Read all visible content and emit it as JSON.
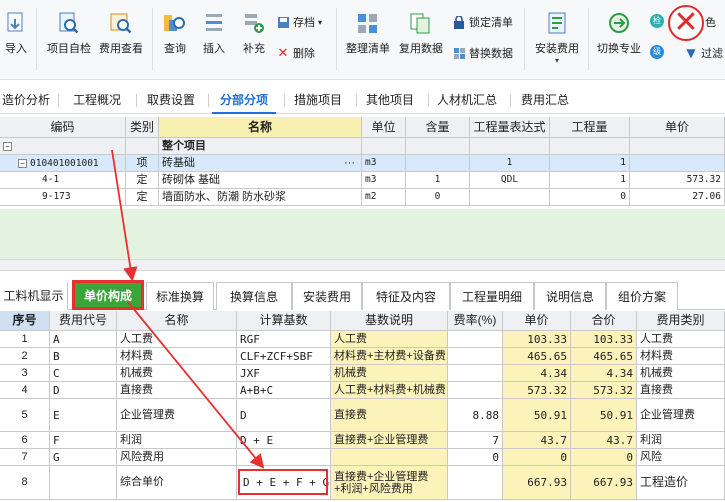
{
  "ribbon": {
    "import": "导入",
    "self_check": "项目自检",
    "fee_view": "费用查看",
    "query": "查询",
    "insert": "插入",
    "supplement": "补充",
    "archive": "存档",
    "delete": "删除",
    "organize": "整理清单",
    "reuse": "复用数据",
    "lock": "锁定清单",
    "replace": "替换数据",
    "install_fee": "安装费用",
    "switch_major": "切换专业",
    "filter": "过滤",
    "color_fragment": "色",
    "badge_1": "检",
    "badge_2": "级"
  },
  "top_tabs": [
    "造价分析",
    "工程概况",
    "取费设置",
    "分部分项",
    "措施项目",
    "其他项目",
    "人材机汇总",
    "费用汇总"
  ],
  "top_active": "分部分项",
  "grid1": {
    "headers": [
      "编码",
      "类别",
      "名称",
      "单位",
      "含量",
      "工程量表达式",
      "工程量",
      "单价"
    ],
    "whole_project": "整个项目",
    "rows": [
      {
        "code": "010401001001",
        "cat": "项",
        "name": "砖基础",
        "unit": "m3",
        "amount": "",
        "expr": "1",
        "qty": "1",
        "price": ""
      },
      {
        "code": "4-1",
        "cat": "定",
        "name": "砖砌体 基础",
        "unit": "m3",
        "amount": "1",
        "expr": "QDL",
        "qty": "1",
        "price": "573.32"
      },
      {
        "code": "9-173",
        "cat": "定",
        "name": "墙面防水、防潮 防水砂浆",
        "unit": "m2",
        "amount": "0",
        "expr": "",
        "qty": "0",
        "price": "27.06"
      }
    ],
    "more_indicator": "···"
  },
  "bottom_tabs": [
    "工料机显示",
    "单价构成",
    "标准换算",
    "换算信息",
    "安装费用",
    "特征及内容",
    "工程量明细",
    "说明信息",
    "组价方案"
  ],
  "bottom_active": "单价构成",
  "grid2": {
    "headers": [
      "序号",
      "费用代号",
      "名称",
      "计算基数",
      "基数说明",
      "费率(%)",
      "单价",
      "合价",
      "费用类别"
    ],
    "rows": [
      {
        "seq": "1",
        "code": "A",
        "name": "人工费",
        "base": "RGF",
        "desc": "人工费",
        "rate": "",
        "price": "103.33",
        "total": "103.33",
        "cat": "人工费"
      },
      {
        "seq": "2",
        "code": "B",
        "name": "材料费",
        "base": "CLF+ZCF+SBF",
        "desc": "材料费+主材费+设备费",
        "rate": "",
        "price": "465.65",
        "total": "465.65",
        "cat": "材料费"
      },
      {
        "seq": "3",
        "code": "C",
        "name": "机械费",
        "base": "JXF",
        "desc": "机械费",
        "rate": "",
        "price": "4.34",
        "total": "4.34",
        "cat": "机械费"
      },
      {
        "seq": "4",
        "code": "D",
        "name": "直接费",
        "base": "A+B+C",
        "desc": "人工费+材料费+机械费",
        "rate": "",
        "price": "573.32",
        "total": "573.32",
        "cat": "直接费"
      },
      {
        "seq": "5",
        "code": "E",
        "name": "企业管理费",
        "base": "D",
        "desc": "直接费",
        "rate": "8.88",
        "price": "50.91",
        "total": "50.91",
        "cat": "企业管理费"
      },
      {
        "seq": "6",
        "code": "F",
        "name": "利润",
        "base": "D + E",
        "desc": "直接费+企业管理费",
        "rate": "7",
        "price": "43.7",
        "total": "43.7",
        "cat": "利润"
      },
      {
        "seq": "7",
        "code": "G",
        "name": "风险费用",
        "base": "",
        "desc": "",
        "rate": "0",
        "price": "0",
        "total": "0",
        "cat": "风险"
      },
      {
        "seq": "8",
        "code": "",
        "name": "综合单价",
        "base": "D + E + F + G",
        "desc": "直接费+企业管理费+利润+风险费用",
        "rate": "",
        "price": "667.93",
        "total": "667.93",
        "cat": "工程造价"
      }
    ]
  }
}
